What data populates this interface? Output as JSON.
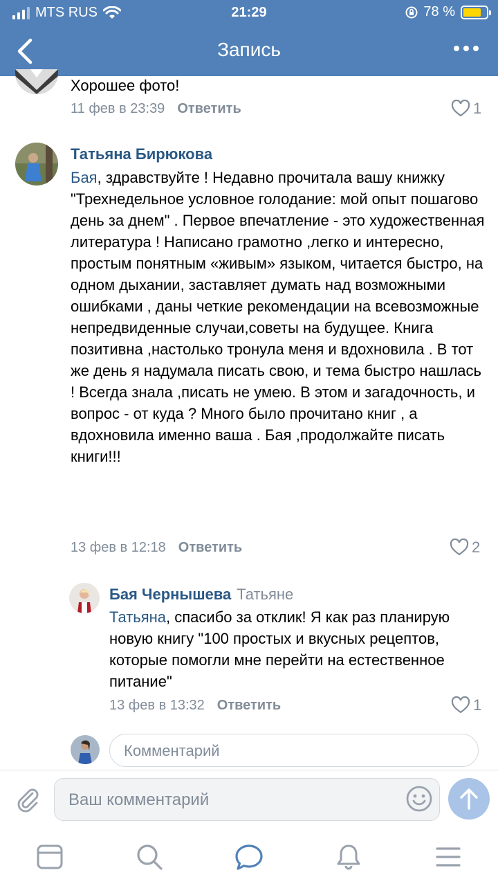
{
  "status": {
    "carrier": "MTS RUS",
    "time": "21:29",
    "battery": "78 %",
    "battery_level": 0.78
  },
  "nav": {
    "title": "Запись"
  },
  "comments": [
    {
      "text": "Хорошее фото!",
      "date": "11 фев в 23:39",
      "reply": "Ответить",
      "likes": "1"
    },
    {
      "author": "Татьяна Бирюкова",
      "mention": "Бая",
      "text": ", здравствуйте ! Недавно прочитала вашу книжку \"Трехнедельное условное голодание: мой опыт пошагово день за днем\" . Первое впечатление - это художественная литература ! Написано грамотно ,легко и интересно, простым понятным «живым» языком, читается быстро, на одном дыхании, заставляет думать над возможными ошибками , даны четкие рекомендации на всевозможные непредвиденные случаи,советы на будущее. Книга позитивна ,настолько тронула меня и вдохновила . В тот же день я надумала писать свою, и тема быстро нашлась ! Всегда знала ,писать не умею. В этом и загадочность, и вопрос - от куда ? Много было прочитано книг , а вдохновила именно ваша . Бая ,продолжайте писать книги!!!",
      "date": "13 фев в 12:18",
      "reply": "Ответить",
      "likes": "2"
    },
    {
      "author": "Бая Чернышева",
      "to": "Татьяне",
      "mention": "Татьяна",
      "text": ", спасибо за отклик! Я как раз планирую новую книгу \"100 простых и вкусных рецептов, которые помогли мне перейти на естественное питание\"",
      "date": "13 фев в 13:32",
      "reply": "Ответить",
      "likes": "1"
    }
  ],
  "inline_comment": {
    "placeholder": "Комментарий"
  },
  "composer": {
    "placeholder": "Ваш комментарий"
  },
  "icons": {
    "back": "chevron-left-icon",
    "more": "more-horizontal-icon",
    "like": "heart-outline-icon",
    "attach": "paperclip-icon",
    "emoji": "smile-icon",
    "send": "arrow-up-icon",
    "tabs": [
      "news-icon",
      "search-icon",
      "messages-icon",
      "notifications-icon",
      "menu-icon"
    ]
  },
  "colors": {
    "header": "#5181b8",
    "link": "#2a5885",
    "secondary": "#818c99",
    "send_button": "#a9c4e6"
  }
}
